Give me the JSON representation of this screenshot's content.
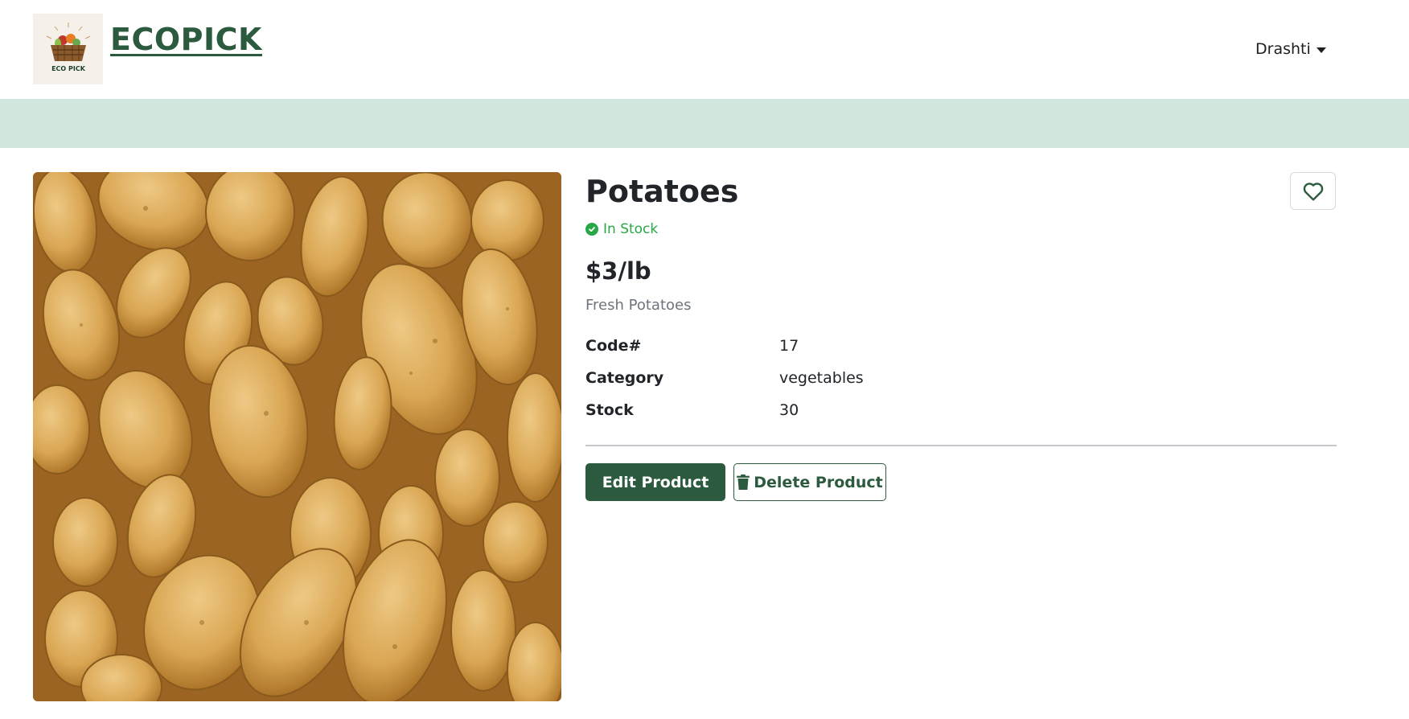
{
  "header": {
    "logo_text": "ECO PICK",
    "brand": "ECOPICK",
    "user_name": "Drashti",
    "user_menu_icon": "caret-down-icon"
  },
  "colors": {
    "brand_green": "#2b5a3e",
    "band": "#d1e7dd",
    "in_stock": "#28a745"
  },
  "product": {
    "name": "Potatoes",
    "status": "In Stock",
    "price": "$3/lb",
    "description": "Fresh Potatoes",
    "specs": [
      {
        "label": "Code#",
        "value": "17"
      },
      {
        "label": "Category",
        "value": "vegetables"
      },
      {
        "label": "Stock",
        "value": "30"
      }
    ],
    "favorite_icon": "heart-outline-icon"
  },
  "actions": {
    "edit_label": "Edit Product",
    "delete_label": "Delete Product",
    "delete_icon": "trash-icon"
  }
}
